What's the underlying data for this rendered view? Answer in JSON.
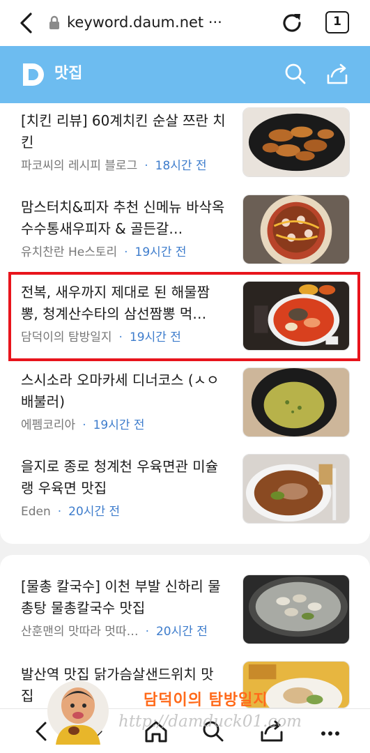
{
  "browser": {
    "url": "keyword.daum.net ···",
    "tab_count": "1"
  },
  "header": {
    "title": "맛집"
  },
  "feed": [
    {
      "title": "[치킨 리뷰] 60계치킨 순살 쯔란 치킨",
      "source": "파코씨의 레시피 블로그",
      "time": "18시간 전",
      "thumb": "fried-chicken"
    },
    {
      "title": "맘스터치&피자 추천 신메뉴 바삭옥수수통새우피자 & 골든갈…",
      "source": "유치찬란 He스토리",
      "time": "19시간 전",
      "thumb": "pizza"
    },
    {
      "title": "전복, 새우까지 제대로 된 해물짬뽕, 청계산수타의 삼선짬뽕 먹…",
      "source": "담덕이의 탐방일지",
      "time": "19시간 전",
      "thumb": "jjamppong"
    },
    {
      "title": "스시소라 오마카세 디너코스 (ㅅㅇ배불러)",
      "source": "에펨코리아",
      "time": "19시간 전",
      "thumb": "soup-bowl"
    },
    {
      "title": "을지로 종로 청계천 우육면관 미슐랭 우육면 맛집",
      "source": "Eden",
      "time": "20시간 전",
      "thumb": "beef-noodle"
    },
    {
      "title": "[물총 칼국수] 이천 부발 신하리 물총탕 물총칼국수 맛집",
      "source": "산훈맨의 맛따라 멋따…",
      "time": "20시간 전",
      "thumb": "clam-stew"
    },
    {
      "title": "발산역 맛집 닭가슴살샌드위치 맛집",
      "source": "",
      "time": "",
      "thumb": "sandwich"
    }
  ],
  "watermark": {
    "brand": "담덕이의 탐방일지",
    "url": "http://damduck01.com"
  },
  "colors": {
    "header_bg": "#6dbcf0",
    "highlight": "#e8141c",
    "time_text": "#3d7ccc"
  },
  "icons": [
    "back-arrow-icon",
    "lock-icon",
    "reload-icon",
    "tabs-icon",
    "daum-logo-icon",
    "search-icon",
    "share-icon",
    "nav-back-icon",
    "nav-forward-icon",
    "home-icon",
    "nav-search-icon",
    "nav-share-icon",
    "more-icon"
  ]
}
